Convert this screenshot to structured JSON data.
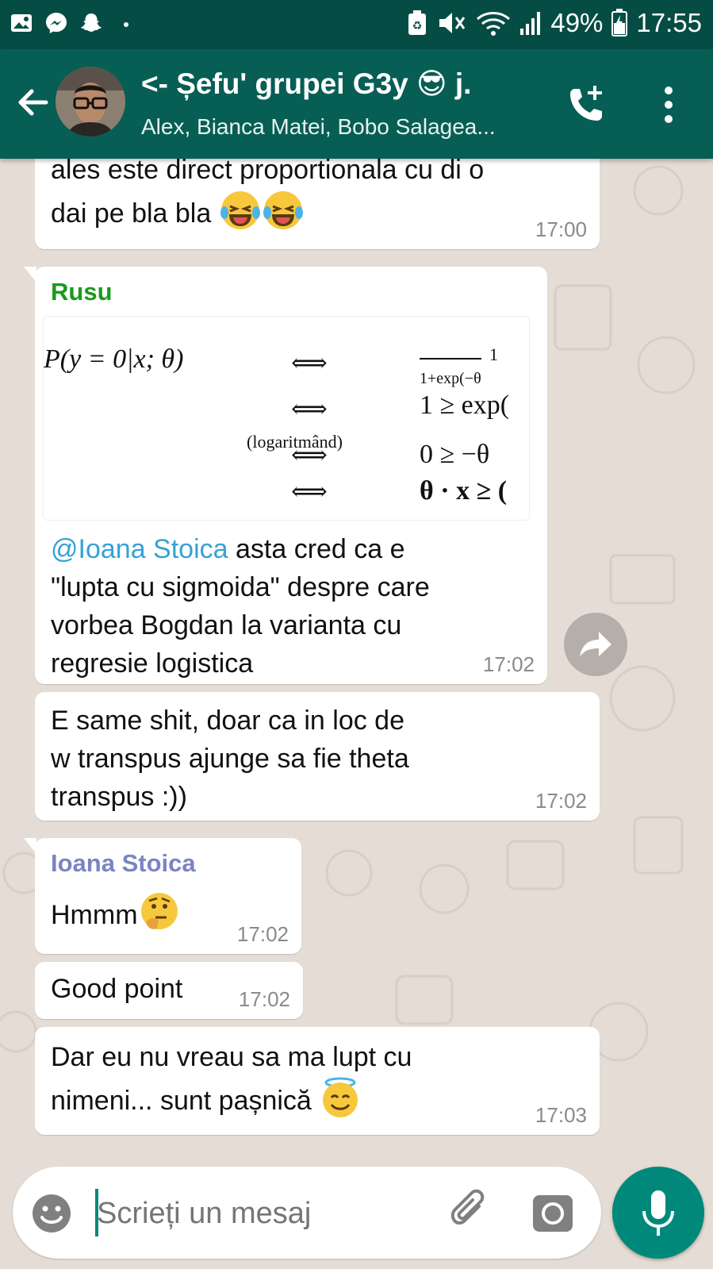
{
  "status_bar": {
    "battery": "49%",
    "time": "17:55"
  },
  "header": {
    "back_label": "back",
    "title": "<- Șefu' grupei G3y 😎 j.",
    "subtitle": "Alex, Bianca Matei, Bobo Salagea..."
  },
  "messages": [
    {
      "sender": "",
      "text_lines": [
        "ales este direct proportionala cu di o",
        "dai pe bla bla"
      ],
      "time": "17:00"
    },
    {
      "sender": "Rusu",
      "mention": "@Ioana Stoica",
      "text_lines": [
        " asta cred ca e",
        "\"lupta cu sigmoida\" despre care",
        "vorbea Bogdan la varianta cu",
        "regresie logistica"
      ],
      "time": "17:02",
      "image": {
        "lhs": "P(y = 0|x; θ)",
        "equiv": "⟺",
        "note": "(logaritmând)",
        "rhs1_num": "1",
        "rhs1_den": "1+exp(−θ",
        "rhs2": "1 ≥ exp(",
        "rhs3": "0 ≥ −θ",
        "rhs4": "θ · x ≥ ("
      }
    },
    {
      "sender": "",
      "text_lines": [
        "E same shit, doar ca in loc de",
        "w transpus ajunge sa fie theta",
        "transpus :))"
      ],
      "time": "17:02"
    },
    {
      "sender": "Ioana Stoica",
      "text_lines": [
        "Hmmm"
      ],
      "time": "17:02"
    },
    {
      "sender": "",
      "text_lines": [
        "Good point"
      ],
      "time": "17:02"
    },
    {
      "sender": "",
      "text_lines": [
        "Dar eu nu vreau sa ma lupt cu",
        "nimeni... sunt pașnică"
      ],
      "time": "17:03"
    }
  ],
  "composer": {
    "placeholder": "Scrieți un mesaj"
  },
  "colors": {
    "header": "#075e54",
    "status_bar": "#054d44",
    "chat_bg": "#e5ddd5",
    "sender_rusu": "#1a9a1a",
    "sender_ioana": "#7a84c4",
    "mention": "#34a2d6",
    "mic_button": "#00897b"
  },
  "icons": [
    "gallery-icon",
    "messenger-icon",
    "snapchat-icon",
    "battery-saver-icon",
    "mute-icon",
    "wifi-icon",
    "signal-icon",
    "battery-icon",
    "back-arrow-icon",
    "add-call-icon",
    "more-vert-icon",
    "forward-icon",
    "emoji-icon",
    "attach-icon",
    "camera-icon",
    "mic-icon"
  ]
}
